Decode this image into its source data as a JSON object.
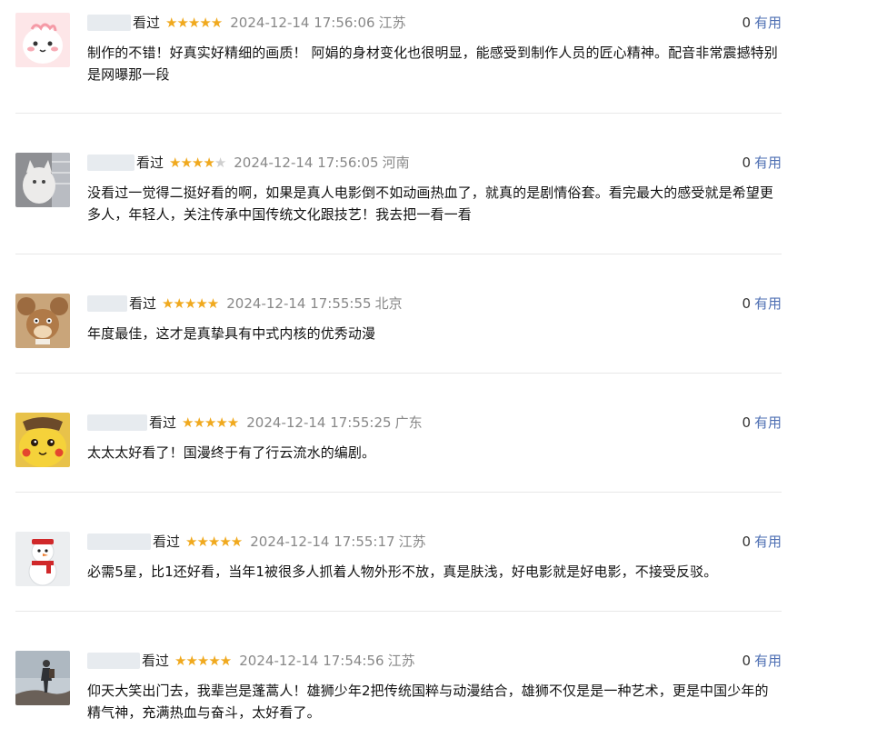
{
  "comments": [
    {
      "username": "",
      "seen": "看过",
      "rating": 5,
      "stars_text": "★★★★★",
      "time": "2024-12-14 17:56:06",
      "location": "江苏",
      "useful_count": "0",
      "useful_label": "有用",
      "text": "制作的不错！好真实好精细的画质！ 阿娟的身材变化也很明显，能感受到制作人员的匠心精神。配音非常震撼特别是网曝那一段",
      "avatar_icon": "pink-cartoon-avatar-icon"
    },
    {
      "username": "",
      "seen": "看过",
      "rating": 4,
      "stars_text": "★★★★",
      "stars_off_text": "★",
      "time": "2024-12-14 17:56:05",
      "location": "河南",
      "useful_count": "0",
      "useful_label": "有用",
      "text": "没看过一觉得二挺好看的啊，如果是真人电影倒不如动画热血了，就真的是剧情俗套。看完最大的感受就是希望更多人，年轻人，关注传承中国传统文化跟技艺！我去把一看一看",
      "avatar_icon": "white-cat-avatar-icon"
    },
    {
      "username": "",
      "seen": "看过",
      "rating": 5,
      "stars_text": "★★★★★",
      "time": "2024-12-14 17:55:55",
      "location": "北京",
      "useful_count": "0",
      "useful_label": "有用",
      "text": "年度最佳，这才是真挚具有中式内核的优秀动漫",
      "avatar_icon": "cartoon-mouse-avatar-icon"
    },
    {
      "username": "",
      "seen": "看过",
      "rating": 5,
      "stars_text": "★★★★★",
      "time": "2024-12-14 17:55:25",
      "location": "广东",
      "useful_count": "0",
      "useful_label": "有用",
      "text": "太太太好看了！国漫终于有了行云流水的编剧。",
      "avatar_icon": "yellow-pikachu-avatar-icon"
    },
    {
      "username": "",
      "seen": "看过",
      "rating": 5,
      "stars_text": "★★★★★",
      "time": "2024-12-14 17:55:17",
      "location": "江苏",
      "useful_count": "0",
      "useful_label": "有用",
      "text": "必需5星，比1还好看，当年1被很多人抓着人物外形不放，真是肤浅，好电影就是好电影，不接受反驳。",
      "avatar_icon": "snowman-avatar-icon"
    },
    {
      "username": "",
      "seen": "看过",
      "rating": 5,
      "stars_text": "★★★★★",
      "time": "2024-12-14 17:54:56",
      "location": "江苏",
      "useful_count": "0",
      "useful_label": "有用",
      "text": "仰天大笑出门去，我辈岂是蓬蒿人！雄狮少年2把传统国粹与动漫结合，雄狮不仅是是一种艺术，更是中国少年的精气神，充满热血与奋斗，太好看了。",
      "avatar_icon": "hiker-photo-avatar-icon"
    }
  ],
  "colors": {
    "star": "#f0a91e",
    "star_off": "#cfcfcf",
    "useful": "#4e6fb3",
    "meta_gray": "#888888",
    "divider": "#e8e8e8"
  }
}
